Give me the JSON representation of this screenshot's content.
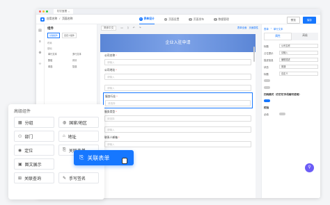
{
  "window": {
    "tab_title": "钉钉宜搭"
  },
  "header": {
    "app_name": "应用名称",
    "page_name": "页面名称",
    "tabs": [
      {
        "n": "1",
        "label": "表单设计"
      },
      {
        "n": "2",
        "label": "页面设置"
      },
      {
        "n": "3",
        "label": "页面发布"
      },
      {
        "n": "4",
        "label": "数据管理"
      }
    ],
    "preview": "预览",
    "save": "保存"
  },
  "left": {
    "title": "组件",
    "tab_basic": "基础组件",
    "tab_custom": "自定义组件",
    "section_layout": "布局",
    "section_basic": "基础",
    "items": [
      "单行文本",
      "多行文本",
      "数值",
      "评分",
      "单选",
      "复选"
    ]
  },
  "canvas": {
    "device": "简体中文",
    "meta": [
      "表单全面",
      "页面属性"
    ]
  },
  "form": {
    "title": "企业入驻申请",
    "fields": [
      {
        "label": "公司名称",
        "placeholder": "请输入"
      },
      {
        "label": "公司地址",
        "placeholder": "请输入"
      },
      {
        "label": "",
        "placeholder": "请输入"
      },
      {
        "label": "服务行业",
        "placeholder": "请选择"
      },
      {
        "label": "服务类型",
        "placeholder": "请选择"
      },
      {
        "label": "",
        "placeholder": "请输入"
      },
      {
        "label": "联系人邮箱",
        "placeholder": "请输入"
      }
    ]
  },
  "right": {
    "crumb": [
      "表单",
      "单行文本"
    ],
    "tab_attr": "属性",
    "tab_adv": "高级",
    "rows": [
      {
        "k": "标题",
        "v": "公司名称"
      },
      {
        "k": "占位提示",
        "v": "请输入"
      },
      {
        "k": "描述信息",
        "v": "编辑描述"
      },
      {
        "k": "状态",
        "v": "普通"
      },
      {
        "k": "标题",
        "v": "自定义"
      }
    ],
    "sec_fmt": "扫码模式（仅钉钉手机端可使用）",
    "sec_verify": "校验",
    "req": "必填"
  },
  "overlay": {
    "title": "高级组件",
    "items": [
      {
        "icon": "grid-icon",
        "g": "▦",
        "label": "分组"
      },
      {
        "icon": "globe-icon",
        "g": "◍",
        "label": "国家/地区"
      },
      {
        "icon": "org-icon",
        "g": "⚇",
        "label": "部门"
      },
      {
        "icon": "address-icon",
        "g": "⌂",
        "label": "地址"
      },
      {
        "icon": "location-icon",
        "g": "◉",
        "label": "定位"
      },
      {
        "icon": "link-icon",
        "g": "⎘",
        "label": "关联表单"
      },
      {
        "icon": "image-icon",
        "g": "▣",
        "label": "图文展示"
      },
      {
        "icon": "",
        "g": "",
        "label": ""
      },
      {
        "icon": "query-icon",
        "g": "⊞",
        "label": "关联查询"
      },
      {
        "icon": "sign-icon",
        "g": "✎",
        "label": "手写签名"
      }
    ]
  },
  "drag": {
    "label": "关联表单"
  },
  "colors": {
    "accent": "#1677ff"
  }
}
